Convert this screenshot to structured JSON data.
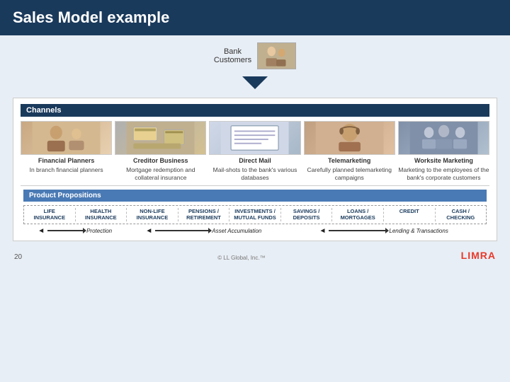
{
  "header": {
    "title": "Sales Model example"
  },
  "bank_customers": {
    "label": "Bank\nCustomers"
  },
  "channels": {
    "header": "Channels",
    "items": [
      {
        "label": "Financial Planners",
        "description": "In branch financial planners",
        "photo_class": "fp"
      },
      {
        "label": "Creditor Business",
        "description": "Mortgage redemption and collateral insurance",
        "photo_class": "cb"
      },
      {
        "label": "Direct Mail",
        "description": "Mail-shots to the bank's various databases",
        "photo_class": "dm"
      },
      {
        "label": "Telemarketing",
        "description": "Carefully planned telemarketing campaigns",
        "photo_class": "tm"
      },
      {
        "label": "Worksite Marketing",
        "description": "Marketing to the employees of the bank's corporate customers",
        "photo_class": "wm"
      }
    ]
  },
  "products": {
    "header": "Product Propositions",
    "items": [
      {
        "top": "LIFE",
        "bottom": "INSURANCE"
      },
      {
        "top": "HEALTH",
        "bottom": "INSURANCE"
      },
      {
        "top": "NON-LIFE",
        "bottom": "INSURANCE"
      },
      {
        "top": "PENSIONS /",
        "bottom": "RETIREMENT"
      },
      {
        "top": "INVESTMENTS /",
        "bottom": "MUTUAL FUNDS"
      },
      {
        "top": "SAVINGS /",
        "bottom": "DEPOSITS"
      },
      {
        "top": "LOANS /",
        "bottom": "MORTGAGES"
      },
      {
        "top": "CREDIT",
        "bottom": ""
      },
      {
        "top": "CASH /",
        "bottom": "CHECKING"
      }
    ],
    "arrows": [
      {
        "label": "Protection",
        "span": 2
      },
      {
        "label": "Asset Accumulation",
        "span": 3
      },
      {
        "label": "Lending & Transactions",
        "span": 3
      }
    ]
  },
  "footer": {
    "page_number": "20",
    "copyright": "© LL Global, Inc.™",
    "logo": "LIMRA"
  }
}
